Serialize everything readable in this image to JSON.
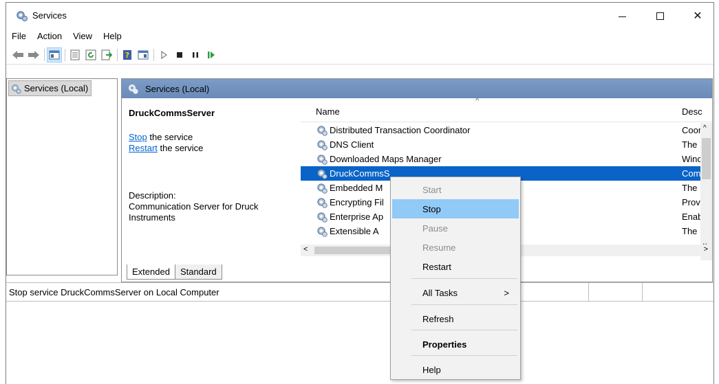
{
  "window": {
    "title": "Services"
  },
  "menu": [
    "File",
    "Action",
    "View",
    "Help"
  ],
  "toolbar": {
    "icons": [
      "back-icon",
      "forward-icon",
      "show-hide-tree-icon",
      "properties-icon",
      "refresh-icon",
      "export-list-icon",
      "help-icon",
      "console-icon",
      "start-service-icon",
      "stop-service-icon",
      "pause-service-icon",
      "resume-service-icon"
    ]
  },
  "tree": {
    "root": "Services (Local)"
  },
  "main": {
    "header": "Services (Local)",
    "detail": {
      "service_name": "DruckCommsServer",
      "stop_link": "Stop",
      "stop_text": " the service",
      "restart_link": "Restart",
      "restart_text": " the service",
      "desc_label": "Description:",
      "desc_text": "Communication Server for Druck Instruments"
    },
    "list": {
      "columns": {
        "name": "Name",
        "desc": "Desc"
      },
      "rows": [
        {
          "name": "Distributed Transaction Coordinator",
          "desc": "Coor"
        },
        {
          "name": "DNS Client",
          "desc": "The"
        },
        {
          "name": "Downloaded Maps Manager",
          "desc": "Winc"
        },
        {
          "name": "DruckCommsS",
          "desc": "Com",
          "selected": true
        },
        {
          "name": "Embedded M",
          "desc": "The"
        },
        {
          "name": "Encrypting Fil",
          "desc": "Prov"
        },
        {
          "name": "Enterprise Ap",
          "desc": "Enab"
        },
        {
          "name": "Extensible A",
          "desc": "The"
        }
      ]
    },
    "tabs": [
      "Extended",
      "Standard"
    ]
  },
  "status": {
    "text": "Stop service DruckCommsServer on Local Computer"
  },
  "context_menu": {
    "items": [
      {
        "label": "Start",
        "state": "disabled"
      },
      {
        "label": "Stop",
        "state": "hover"
      },
      {
        "label": "Pause",
        "state": "disabled"
      },
      {
        "label": "Resume",
        "state": "disabled"
      },
      {
        "label": "Restart",
        "state": "normal"
      },
      {
        "label": "All Tasks",
        "state": "normal",
        "submenu": true
      },
      {
        "label": "Refresh",
        "state": "normal"
      },
      {
        "label": "Properties",
        "state": "bold"
      },
      {
        "label": "Help",
        "state": "normal"
      }
    ]
  },
  "colors": {
    "selection": "#0a64c8",
    "menu_hover": "#91c9f7",
    "header": "#7d9cc7"
  }
}
